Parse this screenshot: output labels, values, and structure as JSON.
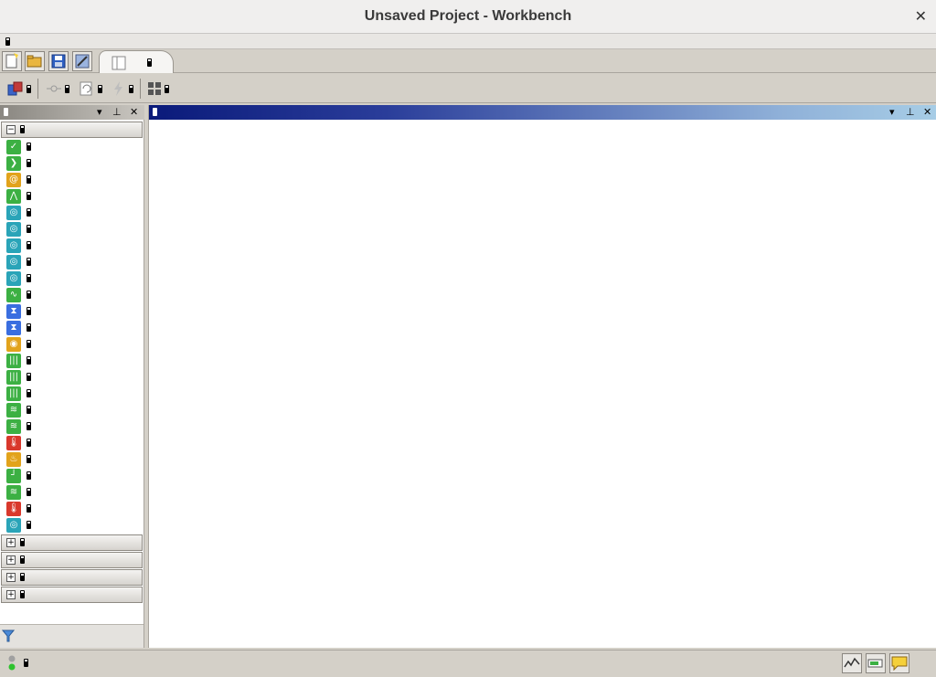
{
  "window": {
    "title": "Unsaved Project - Workbench"
  },
  "toolbox": {
    "items": [
      {
        "icon": "check-icon",
        "color": "#3cb043"
      },
      {
        "icon": "chevron-right-icon",
        "color": "#3cb043"
      },
      {
        "icon": "at-icon",
        "color": "#e2a31b"
      },
      {
        "icon": "graph-icon",
        "color": "#3cb043"
      },
      {
        "icon": "modal-icon",
        "color": "#2aa4b8"
      },
      {
        "icon": "modal-icon",
        "color": "#2aa4b8"
      },
      {
        "icon": "modal-icon",
        "color": "#2aa4b8"
      },
      {
        "icon": "modal-icon",
        "color": "#2aa4b8"
      },
      {
        "icon": "modal-icon",
        "color": "#2aa4b8"
      },
      {
        "icon": "wave-icon",
        "color": "#3cb043"
      },
      {
        "icon": "hourglass-icon",
        "color": "#3a6ee0"
      },
      {
        "icon": "hourglass-icon",
        "color": "#3a6ee0"
      },
      {
        "icon": "target-icon",
        "color": "#e2a31b"
      },
      {
        "icon": "bars-icon",
        "color": "#3cb043"
      },
      {
        "icon": "bars-icon",
        "color": "#3cb043"
      },
      {
        "icon": "bars-icon",
        "color": "#3cb043"
      },
      {
        "icon": "stress-icon",
        "color": "#3cb043"
      },
      {
        "icon": "stress-icon",
        "color": "#3cb043"
      },
      {
        "icon": "thermometer-icon",
        "color": "#d9382c"
      },
      {
        "icon": "thermal-icon",
        "color": "#e2a31b"
      },
      {
        "icon": "pipe-icon",
        "color": "#3cb043"
      },
      {
        "icon": "stress-icon",
        "color": "#3cb043"
      },
      {
        "icon": "thermometer-icon",
        "color": "#d9382c"
      },
      {
        "icon": "modal-icon",
        "color": "#2aa4b8"
      }
    ]
  },
  "colors": {
    "header_gradient_start": "#0a1a7a",
    "header_gradient_end": "#a7cde6"
  }
}
